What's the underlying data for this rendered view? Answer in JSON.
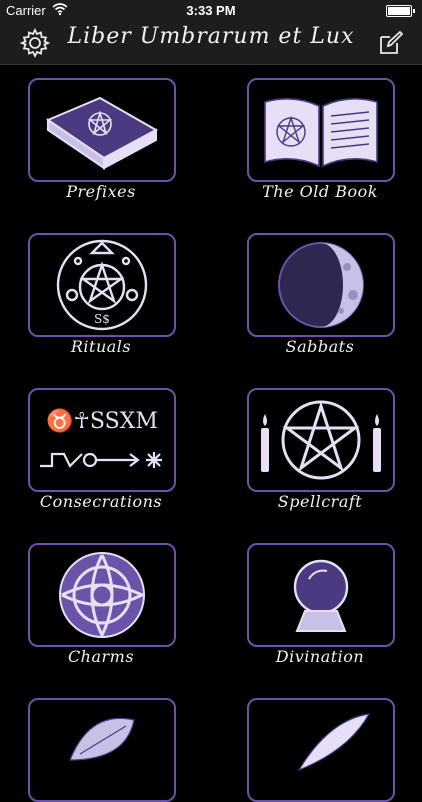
{
  "status_bar": {
    "carrier": "Carrier",
    "time": "3:33 PM"
  },
  "navbar": {
    "title": "Liber Umbrarum et Lux",
    "left_icon": "gear-icon",
    "right_icon": "compose-icon"
  },
  "tiles": [
    {
      "label": "Prefixes",
      "icon": "book-pentagram-icon"
    },
    {
      "label": "The Old Book",
      "icon": "open-book-icon"
    },
    {
      "label": "Rituals",
      "icon": "ritual-pentacle-icon"
    },
    {
      "label": "Sabbats",
      "icon": "moon-phase-icon"
    },
    {
      "label": "Consecrations",
      "icon": "runes-icon"
    },
    {
      "label": "Spellcraft",
      "icon": "pentacle-candles-icon"
    },
    {
      "label": "Charms",
      "icon": "celtic-knot-icon"
    },
    {
      "label": "Divination",
      "icon": "crystal-ball-icon"
    },
    {
      "label": "",
      "icon": "leaf-icon"
    },
    {
      "label": "",
      "icon": "quill-icon"
    }
  ],
  "colors": {
    "accent": "#6a53a8",
    "background": "#000000",
    "bar": "#1d1d1d"
  }
}
